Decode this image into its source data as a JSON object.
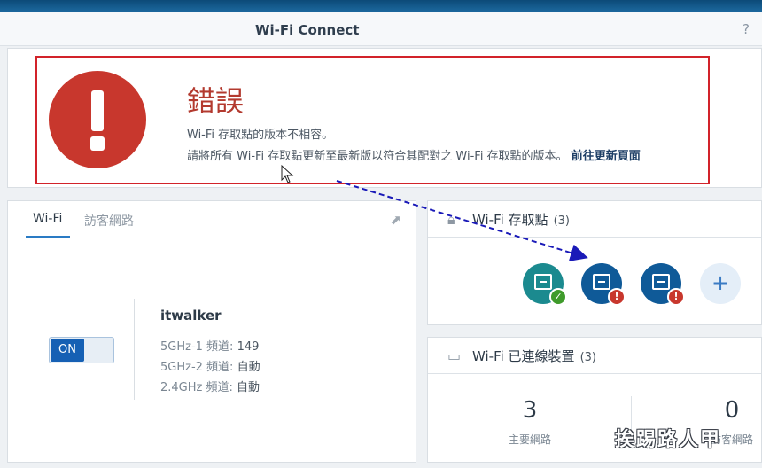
{
  "app": {
    "title": "Wi-Fi Connect",
    "help_icon": "question-icon"
  },
  "error": {
    "title": "錯誤",
    "message_line1": "Wi-Fi 存取點的版本不相容。",
    "message_line2": "請將所有 Wi-Fi 存取點更新至最新版以符合其配對之 Wi-Fi 存取點的版本。",
    "link": "前往更新頁面",
    "icon": "exclamation-icon",
    "icon_color": "#c8372d",
    "highlight_color": "#d2232a"
  },
  "wifi_panel": {
    "tabs": [
      "Wi-Fi",
      "訪客網路"
    ],
    "active_tab": "Wi-Fi",
    "toggle_label": "ON",
    "ssid": "itwalker",
    "bands": [
      {
        "label": "5GHz-1 頻道:",
        "value": "149"
      },
      {
        "label": "5GHz-2 頻道:",
        "value": "自動"
      },
      {
        "label": "2.4GHz 頻道:",
        "value": "自動"
      }
    ]
  },
  "access_points": {
    "title": "Wi-Fi 存取點",
    "count": "(3)",
    "items": [
      {
        "status": "ok",
        "badge": "✓"
      },
      {
        "status": "error",
        "badge": "!"
      },
      {
        "status": "error",
        "badge": "!"
      }
    ],
    "add_label": "+"
  },
  "devices": {
    "title": "Wi-Fi 已連線裝置",
    "count": "(3)",
    "main_count": "3",
    "main_label": "主要網路",
    "guest_count": "0",
    "guest_label": "訪客網路"
  },
  "watermark": "挨踢路人甲",
  "colors": {
    "accent": "#1660b4",
    "ok": "#3f9b2b",
    "error": "#c8372d"
  }
}
